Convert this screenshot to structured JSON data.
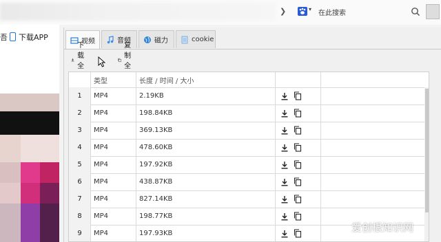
{
  "browser": {
    "search_placeholder": "在此搜索",
    "engine_icon": "paw-icon",
    "chevron": "❯"
  },
  "left_page": {
    "cut_text": "吾",
    "download_app_label": "下载APP"
  },
  "tabs": [
    {
      "label": "视频",
      "icon": "video-icon",
      "active": true
    },
    {
      "label": "音频",
      "icon": "music-icon",
      "active": false
    },
    {
      "label": "磁力",
      "icon": "globe-icon",
      "active": false
    },
    {
      "label": "cookie",
      "icon": "document-icon",
      "active": false
    }
  ],
  "toolbar": {
    "download_all_label": "下载全部",
    "copy_all_label": "复制全部"
  },
  "table": {
    "columns": [
      "",
      "类型",
      "长度 / 时间 / 大小",
      ""
    ],
    "rows": [
      {
        "index": "1",
        "type": "MP4",
        "size": "2.19KB"
      },
      {
        "index": "2",
        "type": "MP4",
        "size": "198.84KB"
      },
      {
        "index": "3",
        "type": "MP4",
        "size": "369.13KB"
      },
      {
        "index": "4",
        "type": "MP4",
        "size": "478.60KB"
      },
      {
        "index": "5",
        "type": "MP4",
        "size": "197.92KB"
      },
      {
        "index": "6",
        "type": "MP4",
        "size": "438.87KB"
      },
      {
        "index": "7",
        "type": "MP4",
        "size": "827.14KB"
      },
      {
        "index": "8",
        "type": "MP4",
        "size": "198.77KB"
      },
      {
        "index": "9",
        "type": "MP4",
        "size": "197.93KB"
      }
    ]
  },
  "watermark": "爱创根知识网"
}
